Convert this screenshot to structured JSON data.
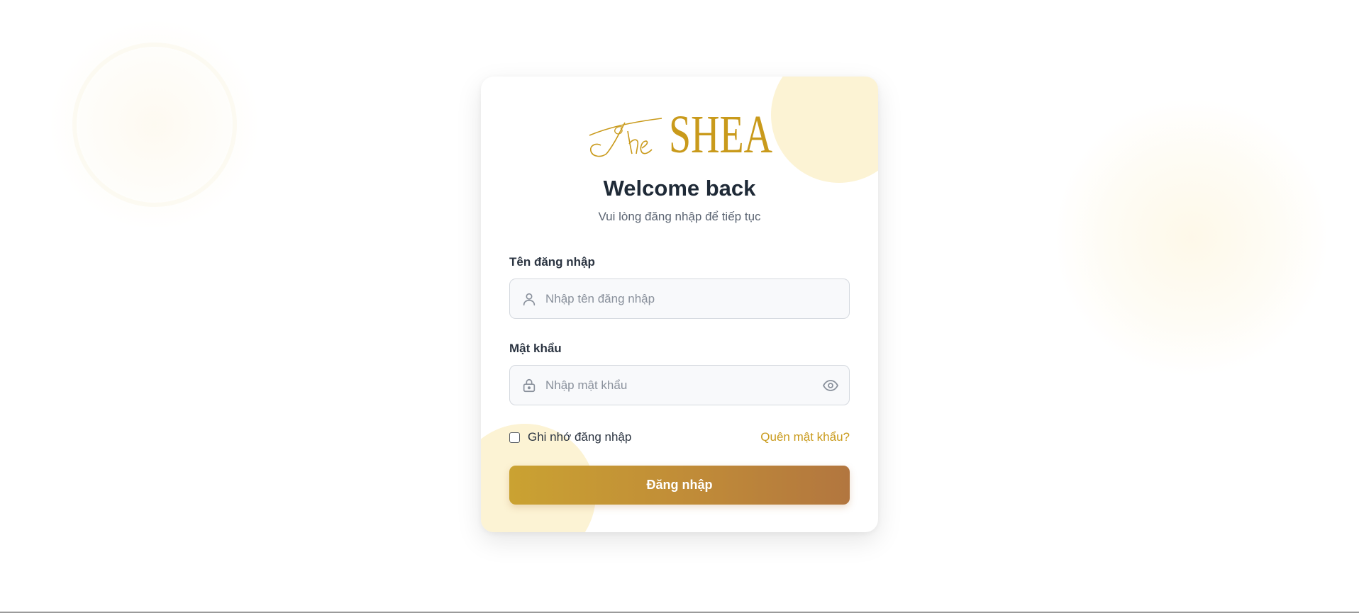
{
  "brand": {
    "logo_text": "The SHEA",
    "logo_script": "The",
    "logo_word": "SHEA",
    "color": "#c99a1b"
  },
  "login": {
    "title": "Welcome back",
    "subtitle": "Vui lòng đăng nhập để tiếp tục",
    "username": {
      "label": "Tên đăng nhập",
      "placeholder": "Nhập tên đăng nhập",
      "value": "",
      "icon": "user-icon"
    },
    "password": {
      "label": "Mật khẩu",
      "placeholder": "Nhập mật khẩu",
      "value": "",
      "icon": "lock-icon",
      "toggle_icon": "eye-icon"
    },
    "remember_label": "Ghi nhớ đăng nhập",
    "remember_checked": false,
    "forgot_label": "Quên mật khẩu?",
    "submit_label": "Đăng nhập"
  },
  "colors": {
    "accent": "#c99a1b",
    "button_gradient_start": "#caa232",
    "button_gradient_end": "#b2763f",
    "heading": "#1f2a37"
  }
}
